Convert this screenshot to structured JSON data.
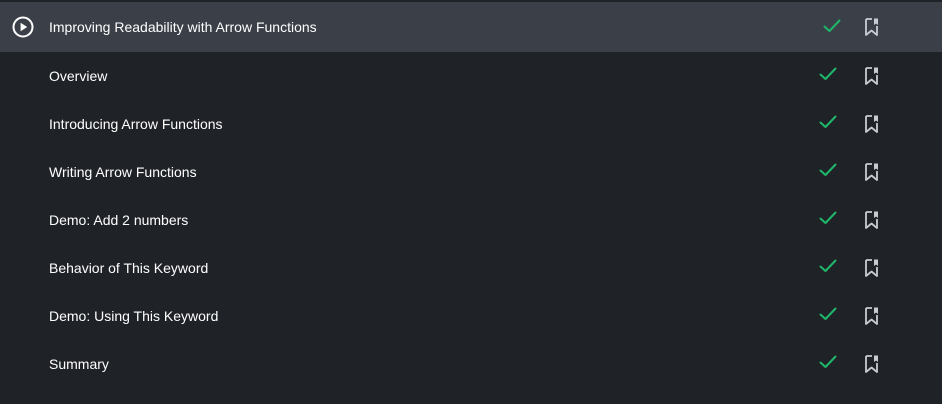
{
  "module": {
    "title": "Improving Readability with Arrow Functions",
    "status": "completed"
  },
  "clips": [
    {
      "title": "Overview",
      "status": "completed"
    },
    {
      "title": "Introducing Arrow Functions",
      "status": "completed"
    },
    {
      "title": "Writing Arrow Functions",
      "status": "completed"
    },
    {
      "title": "Demo: Add 2 numbers",
      "status": "completed"
    },
    {
      "title": "Behavior of This Keyword",
      "status": "completed"
    },
    {
      "title": "Demo: Using This Keyword",
      "status": "completed"
    },
    {
      "title": "Summary",
      "status": "completed"
    }
  ],
  "colors": {
    "background": "#1f2227",
    "module_row": "#3b4048",
    "check": "#1fb86a",
    "text": "#ffffff",
    "icon": "#c8ccd2"
  },
  "icons": {
    "play": "play-circle-icon",
    "completed": "check-icon",
    "bookmark": "bookmark-icon"
  }
}
